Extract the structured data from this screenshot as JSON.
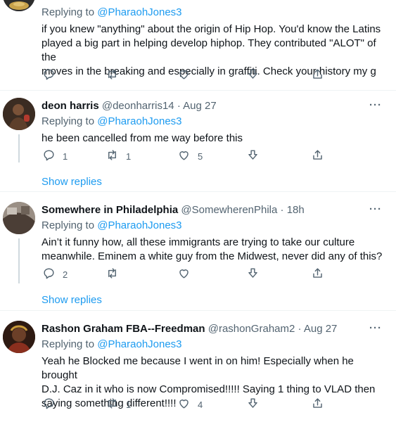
{
  "tweets": [
    {
      "name": "",
      "handle": "",
      "time": "",
      "replying_label": "Replying to",
      "replying_to": "@PharaohJones3",
      "text_lines": [
        "if you knew \"anything\" about the origin of Hip Hop. You'd know the Latins",
        "played a big part in helping develop hiphop. They contributed \"ALOT\" of the",
        "moves in the breaking and especially in graffiti. Check your history my g"
      ],
      "counts": {
        "reply": "",
        "retweet": "",
        "like": ""
      }
    },
    {
      "name": "deon harris",
      "handle": "@deonharris14",
      "separator": "·",
      "time": "Aug 27",
      "replying_label": "Replying to",
      "replying_to": "@PharaohJones3",
      "text_lines": [
        "he been cancelled from me way before this"
      ],
      "counts": {
        "reply": "1",
        "retweet": "1",
        "like": "5"
      },
      "show_replies": "Show replies"
    },
    {
      "name": "Somewhere in Philadelphia",
      "handle": "@SomewherenPhila",
      "separator": "·",
      "time": "18h",
      "replying_label": "Replying to",
      "replying_to": "@PharaohJones3",
      "text_lines": [
        "Ain’t it funny how, all these immigrants are trying to take our culture",
        "meanwhile. Eminem a white guy from the Midwest, never did any of this?"
      ],
      "counts": {
        "reply": "2",
        "retweet": "",
        "like": ""
      },
      "show_replies": "Show replies"
    },
    {
      "name": "Rashon Graham FBA--Freedman",
      "handle": "@rashonGraham2",
      "separator": "·",
      "time": "Aug 27",
      "replying_label": "Replying to",
      "replying_to": "@PharaohJones3",
      "text_lines": [
        "Yeah he Blocked me because I went in on him! Especially when he brought",
        "D.J. Caz in it who is now Compromised!!!!! Saying 1 thing to VLAD then",
        "saying something different!!!!"
      ],
      "counts": {
        "reply": "",
        "retweet": "1",
        "like": "4"
      }
    }
  ],
  "more_glyph": "···",
  "icons": [
    "reply-icon",
    "retweet-icon",
    "like-icon",
    "download-icon",
    "share-icon"
  ],
  "colors": {
    "accent": "#1d9bf0",
    "muted": "#536471",
    "text": "#0f1419",
    "divider": "#eff3f4"
  }
}
